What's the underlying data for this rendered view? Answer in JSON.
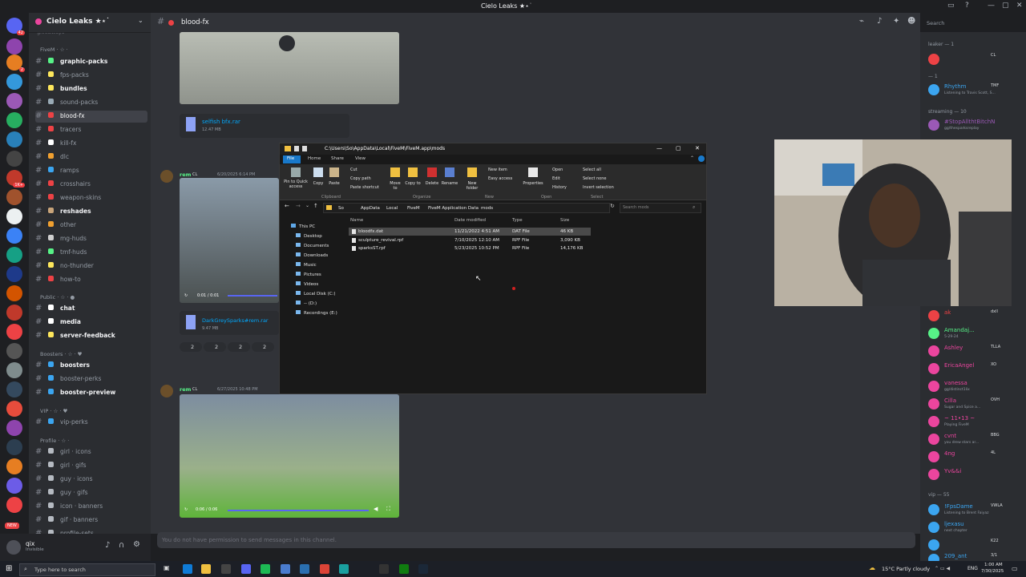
{
  "window": {
    "title": "Cielo Leaks ★⋆˙"
  },
  "server": {
    "name": "Cielo Leaks ★⋆˙",
    "top_partial": "giveaways"
  },
  "categories": {
    "fivem": "FiveM · ☆ ·",
    "public": "Public · ☆ · ●",
    "boosters": "Boosters · ☆ · ♥",
    "vip": "VIP · ☆ · ♥",
    "profile": "Profile · ☆ ·"
  },
  "channels_fivem": [
    {
      "label": "graphic-packs",
      "bold": true,
      "color": "#57f287"
    },
    {
      "label": "fps-packs",
      "bold": false,
      "color": "#fee75c"
    },
    {
      "label": "bundles",
      "bold": true,
      "color": "#fee75c"
    },
    {
      "label": "sound-packs",
      "bold": false,
      "color": "#99aab5"
    },
    {
      "label": "blood-fx",
      "bold": false,
      "color": "#ed4245",
      "active": true
    },
    {
      "label": "tracers",
      "bold": false,
      "color": "#ed4245"
    },
    {
      "label": "kill-fx",
      "bold": false,
      "color": "#ffffff"
    },
    {
      "label": "dlc",
      "bold": false,
      "color": "#f0a030"
    },
    {
      "label": "ramps",
      "bold": false,
      "color": "#3ba5f0"
    },
    {
      "label": "crosshairs",
      "bold": false,
      "color": "#ed4245"
    },
    {
      "label": "weapon-skins",
      "bold": false,
      "color": "#ed4245"
    },
    {
      "label": "reshades",
      "bold": true,
      "color": "#c8a47a"
    },
    {
      "label": "other",
      "bold": false,
      "color": "#f0a030"
    },
    {
      "label": "mg-huds",
      "bold": false,
      "color": "#d0d0d0"
    },
    {
      "label": "tmf-huds",
      "bold": false,
      "color": "#57f287"
    },
    {
      "label": "no-thunder",
      "bold": false,
      "color": "#fee75c"
    },
    {
      "label": "how-to",
      "bold": false,
      "color": "#ed4245"
    }
  ],
  "channels_public": [
    {
      "label": "chat",
      "bold": true,
      "color": "#ffffff"
    },
    {
      "label": "media",
      "bold": true,
      "color": "#ffffff"
    },
    {
      "label": "server-feedback",
      "bold": true,
      "color": "#fee75c"
    }
  ],
  "channels_boosters": [
    {
      "label": "boosters",
      "bold": true,
      "color": "#3ba5f0"
    },
    {
      "label": "booster-perks",
      "bold": false,
      "color": "#3ba5f0"
    },
    {
      "label": "booster-preview",
      "bold": true,
      "color": "#3ba5f0"
    }
  ],
  "channels_vip": [
    {
      "label": "vip-perks",
      "bold": false,
      "color": "#3ba5f0"
    }
  ],
  "channels_profile": [
    {
      "label": "girl · icons",
      "bold": false,
      "color": "#b5bac1"
    },
    {
      "label": "girl · gifs",
      "bold": false,
      "color": "#b5bac1"
    },
    {
      "label": "guy · icons",
      "bold": false,
      "color": "#b5bac1"
    },
    {
      "label": "guy · gifs",
      "bold": false,
      "color": "#b5bac1"
    },
    {
      "label": "icon · banners",
      "bold": false,
      "color": "#b5bac1"
    },
    {
      "label": "gif · banners",
      "bold": false,
      "color": "#b5bac1"
    },
    {
      "label": "profile-sets",
      "bold": false,
      "color": "#b5bac1"
    }
  ],
  "user": {
    "name": "qix",
    "status": "Invisible"
  },
  "chat": {
    "channel": "blood-fx",
    "composer_placeholder": "You do not have permission to send messages in this channel.",
    "search_placeholder": "Search",
    "attachment1": {
      "name": "selfish bfx.rar",
      "size": "12.47 MB"
    },
    "msg1": {
      "author": "rem",
      "tag": "CL",
      "date": "6/20/2025 6:14 PM"
    },
    "video1_time": "0:01 / 0:01",
    "attachment2": {
      "name": "DarkGreySparks#rem.rar",
      "size": "9.47 MB"
    },
    "reactions": [
      "2",
      "2",
      "2",
      "2"
    ],
    "msg2": {
      "author": "rem",
      "tag": "CL",
      "date": "6/27/2025 10:48 PM"
    },
    "video2_time": "0:06 / 0:06"
  },
  "explorer": {
    "path": "C:\\Users\\So\\AppData\\Local\\FiveM\\FiveM.app\\mods",
    "tabs": [
      "File",
      "Home",
      "Share",
      "View"
    ],
    "ribbon": {
      "pin": "Pin to Quick access",
      "copy": "Copy",
      "paste": "Paste",
      "cut": "Cut",
      "copy_path": "Copy path",
      "paste_shortcut": "Paste shortcut",
      "move_to": "Move to",
      "copy_to": "Copy to",
      "delete": "Delete",
      "rename": "Rename",
      "new_folder": "New folder",
      "new_item": "New item",
      "easy_access": "Easy access",
      "properties": "Properties",
      "open": "Open",
      "edit": "Edit",
      "history": "History",
      "select_all": "Select all",
      "select_none": "Select none",
      "invert_selection": "Invert selection",
      "groups": [
        "Clipboard",
        "Organize",
        "New",
        "Open",
        "Select"
      ]
    },
    "breadcrumb": [
      "So",
      "AppData",
      "Local",
      "FiveM",
      "FiveM Application Data",
      "mods"
    ],
    "search_placeholder": "Search mods",
    "nav": [
      "This PC",
      "Desktop",
      "Documents",
      "Downloads",
      "Music",
      "Pictures",
      "Videos",
      "Local Disk (C:)",
      "-- (D:)",
      "Recordings (E:)"
    ],
    "columns": [
      "Name",
      "Date modified",
      "Type",
      "Size"
    ],
    "files": [
      {
        "name": "bloodfx.dat",
        "date": "11/21/2022 4:51 AM",
        "type": "DAT File",
        "size": "46 KB",
        "selected": true
      },
      {
        "name": "sculpture_revival.rpf",
        "date": "7/10/2025 12:10 AM",
        "type": "RPF File",
        "size": "3,090 KB"
      },
      {
        "name": "sparksST.rpf",
        "date": "5/23/2025 10:52 PM",
        "type": "RPF File",
        "size": "14,176 KB"
      }
    ]
  },
  "members": {
    "cat_leaker": "leaker — 1",
    "cat_bots": "— 1",
    "cat_streaming": "streaming — 10",
    "cat_vip": "vip — 55",
    "list": [
      {
        "name": "",
        "tag": "CL",
        "status": "",
        "color": "#ed4245"
      },
      {
        "name": "Rhythm",
        "tag": "TMF",
        "status": "Listening to Travis Scott, S...",
        "color": "#3ba5f0"
      },
      {
        "name": "#StopAllthtBitchN",
        "tag": "",
        "status": "gg/thesparksreplay",
        "color": "#9b59b6"
      },
      {
        "name": "ak",
        "tag": "dxll",
        "status": "",
        "color": "#ed4245"
      },
      {
        "name": "Amandaj...",
        "tag": "",
        "status": "5-29-24",
        "color": "#57f287"
      },
      {
        "name": "Ashley",
        "tag": "TLLA",
        "status": "",
        "color": "#eb459e"
      },
      {
        "name": "EricaAngel",
        "tag": "XO",
        "status": "",
        "color": "#eb459e"
      },
      {
        "name": "vanessa",
        "tag": "",
        "status": "gg/distinct1lix",
        "color": "#eb459e"
      },
      {
        "name": "Cilla",
        "tag": "OVH",
        "status": "Sugar and Spice a...",
        "color": "#eb459e"
      },
      {
        "name": "~ 11•13 ~",
        "tag": "",
        "status": "Playing FiveM",
        "color": "#eb459e"
      },
      {
        "name": "cvnt",
        "tag": "BBG",
        "status": "you drew stars ar...",
        "color": "#eb459e"
      },
      {
        "name": "4ng",
        "tag": "4L",
        "status": "",
        "color": "#eb459e"
      },
      {
        "name": "Yv&&i",
        "tag": "",
        "status": "",
        "color": "#eb459e"
      },
      {
        "name": "!FpsDame",
        "tag": "VWLA",
        "status": "Listening to Brent Faiyaz",
        "color": "#3ba5f0"
      },
      {
        "name": "ljexasu",
        "tag": "",
        "status": "next chapter",
        "color": "#3ba5f0"
      },
      {
        "name": "",
        "tag": "K22",
        "status": "",
        "color": "#3ba5f0"
      },
      {
        "name": "209_ant",
        "tag": "3/1",
        "status": "",
        "color": "#3ba5f0"
      }
    ]
  },
  "taskbar": {
    "search": "Type here to search",
    "weather": "15°C  Partly cloudy",
    "lang": "ENG",
    "time": "1:00 AM",
    "date": "7/30/2025"
  }
}
